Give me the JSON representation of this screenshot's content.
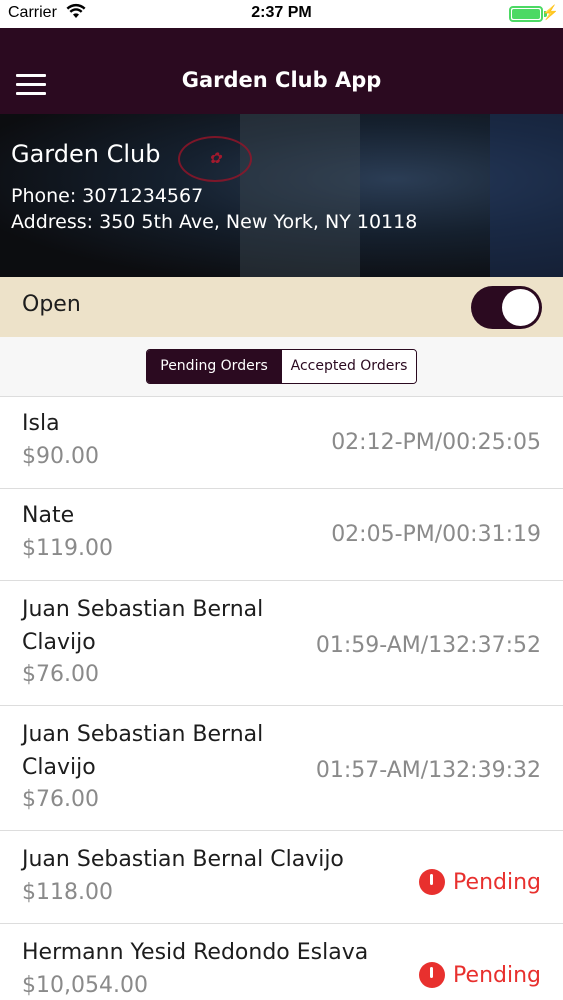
{
  "status_bar": {
    "carrier": "Carrier",
    "time": "2:37 PM"
  },
  "nav": {
    "title": "Garden Club App"
  },
  "restaurant": {
    "name": "Garden Club",
    "phone": "Phone: 3071234567",
    "address": "Address: 350 5th Ave, New York, NY 10118"
  },
  "open_toggle": {
    "label": "Open",
    "on": true
  },
  "tabs": [
    {
      "label": "Pending Orders",
      "active": true
    },
    {
      "label": "Accepted Orders",
      "active": false
    }
  ],
  "orders": [
    {
      "name": "Isla",
      "amount": "$90.00",
      "time": "02:12-PM/00:25:05"
    },
    {
      "name": "Nate",
      "amount": "$119.00",
      "time": "02:05-PM/00:31:19"
    },
    {
      "name": "Juan Sebastian Bernal Clavijo",
      "amount": "$76.00",
      "time": "01:59-AM/132:37:52"
    },
    {
      "name": "Juan Sebastian Bernal Clavijo",
      "amount": "$76.00",
      "time": "01:57-AM/132:39:32"
    },
    {
      "name": "Juan Sebastian Bernal Clavijo",
      "amount": "$118.00",
      "status": "Pending"
    },
    {
      "name": "Hermann Yesid Redondo Eslava",
      "amount": "$10,054.00",
      "status": "Pending"
    }
  ],
  "colors": {
    "brand": "#2b0a20",
    "open_row": "#ede2c9",
    "pending": "#e8302e",
    "battery": "#4cd964"
  }
}
